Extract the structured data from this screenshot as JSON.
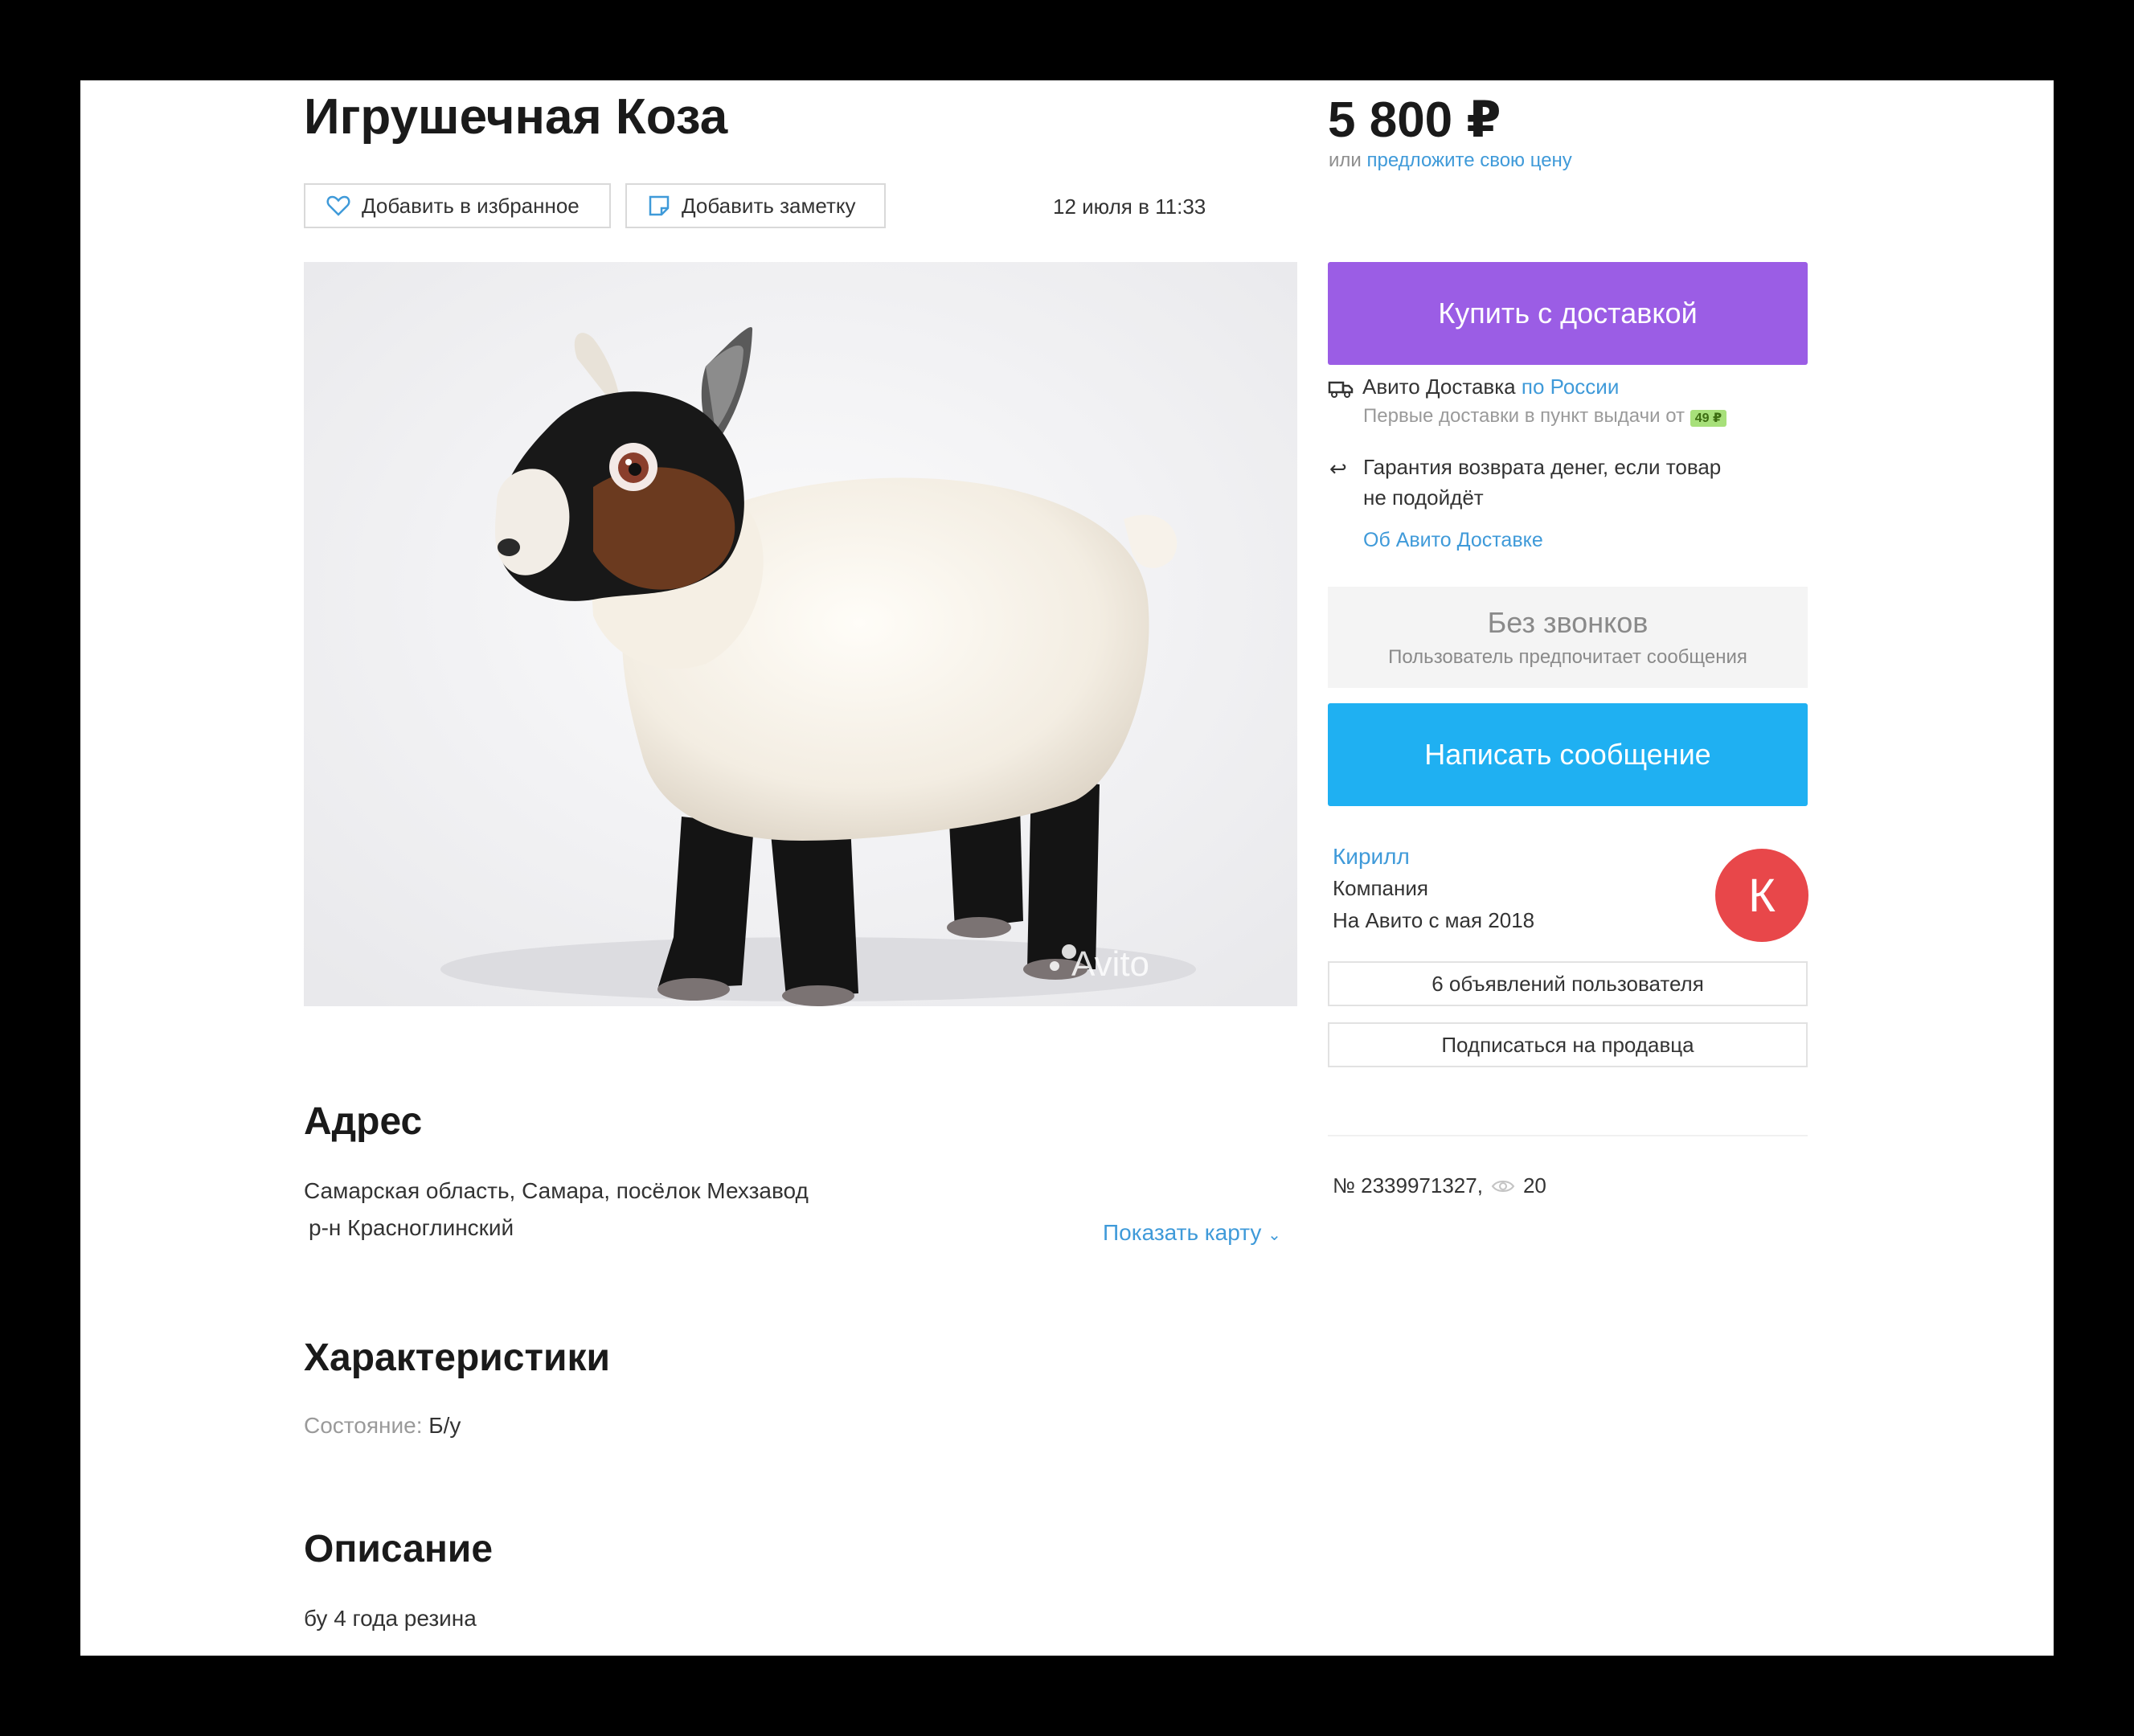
{
  "listing": {
    "title": "Игрушечная Коза",
    "favorite_label": "Добавить в избранное",
    "note_label": "Добавить заметку",
    "date": "12 июля в 11:33",
    "photo_watermark": "Avito"
  },
  "price": {
    "value": "5 800 ₽",
    "alt_prefix": "или",
    "offer_link": "предложите свою цену"
  },
  "delivery": {
    "buy_button": "Купить с доставкой",
    "title": "Авито Доставка",
    "region_link": "по России",
    "first_delivery": "Первые доставки в пункт выдачи от",
    "first_delivery_price": "49 ₽",
    "guarantee_line1": "Гарантия возврата денег, если товар",
    "guarantee_line2": "не подойдёт",
    "about_link": "Об Авито Доставке"
  },
  "contact": {
    "no_calls_title": "Без звонков",
    "no_calls_sub": "Пользователь предпочитает сообщения",
    "message_button": "Написать сообщение"
  },
  "seller": {
    "name": "Кирилл",
    "type": "Компания",
    "since": "На Авито с мая 2018",
    "avatar_letter": "К",
    "listings_button": "6 объявлений пользователя",
    "subscribe_button": "Подписаться на продавца"
  },
  "meta": {
    "number": "№ 2339971327,",
    "views": "20"
  },
  "address": {
    "heading": "Адрес",
    "line1": "Самарская область, Самара, посёлок Мехзавод",
    "line2": "р-н Красноглинский",
    "map_link": "Показать карту"
  },
  "specs": {
    "heading": "Характеристики",
    "condition_label": "Состояние:",
    "condition_value": "Б/у"
  },
  "description": {
    "heading": "Описание",
    "text": "бу 4 года резина"
  },
  "colors": {
    "buy": "#9b5de5",
    "message": "#1fb0f2",
    "link": "#3f9ad9",
    "avatar": "#e8474a"
  }
}
